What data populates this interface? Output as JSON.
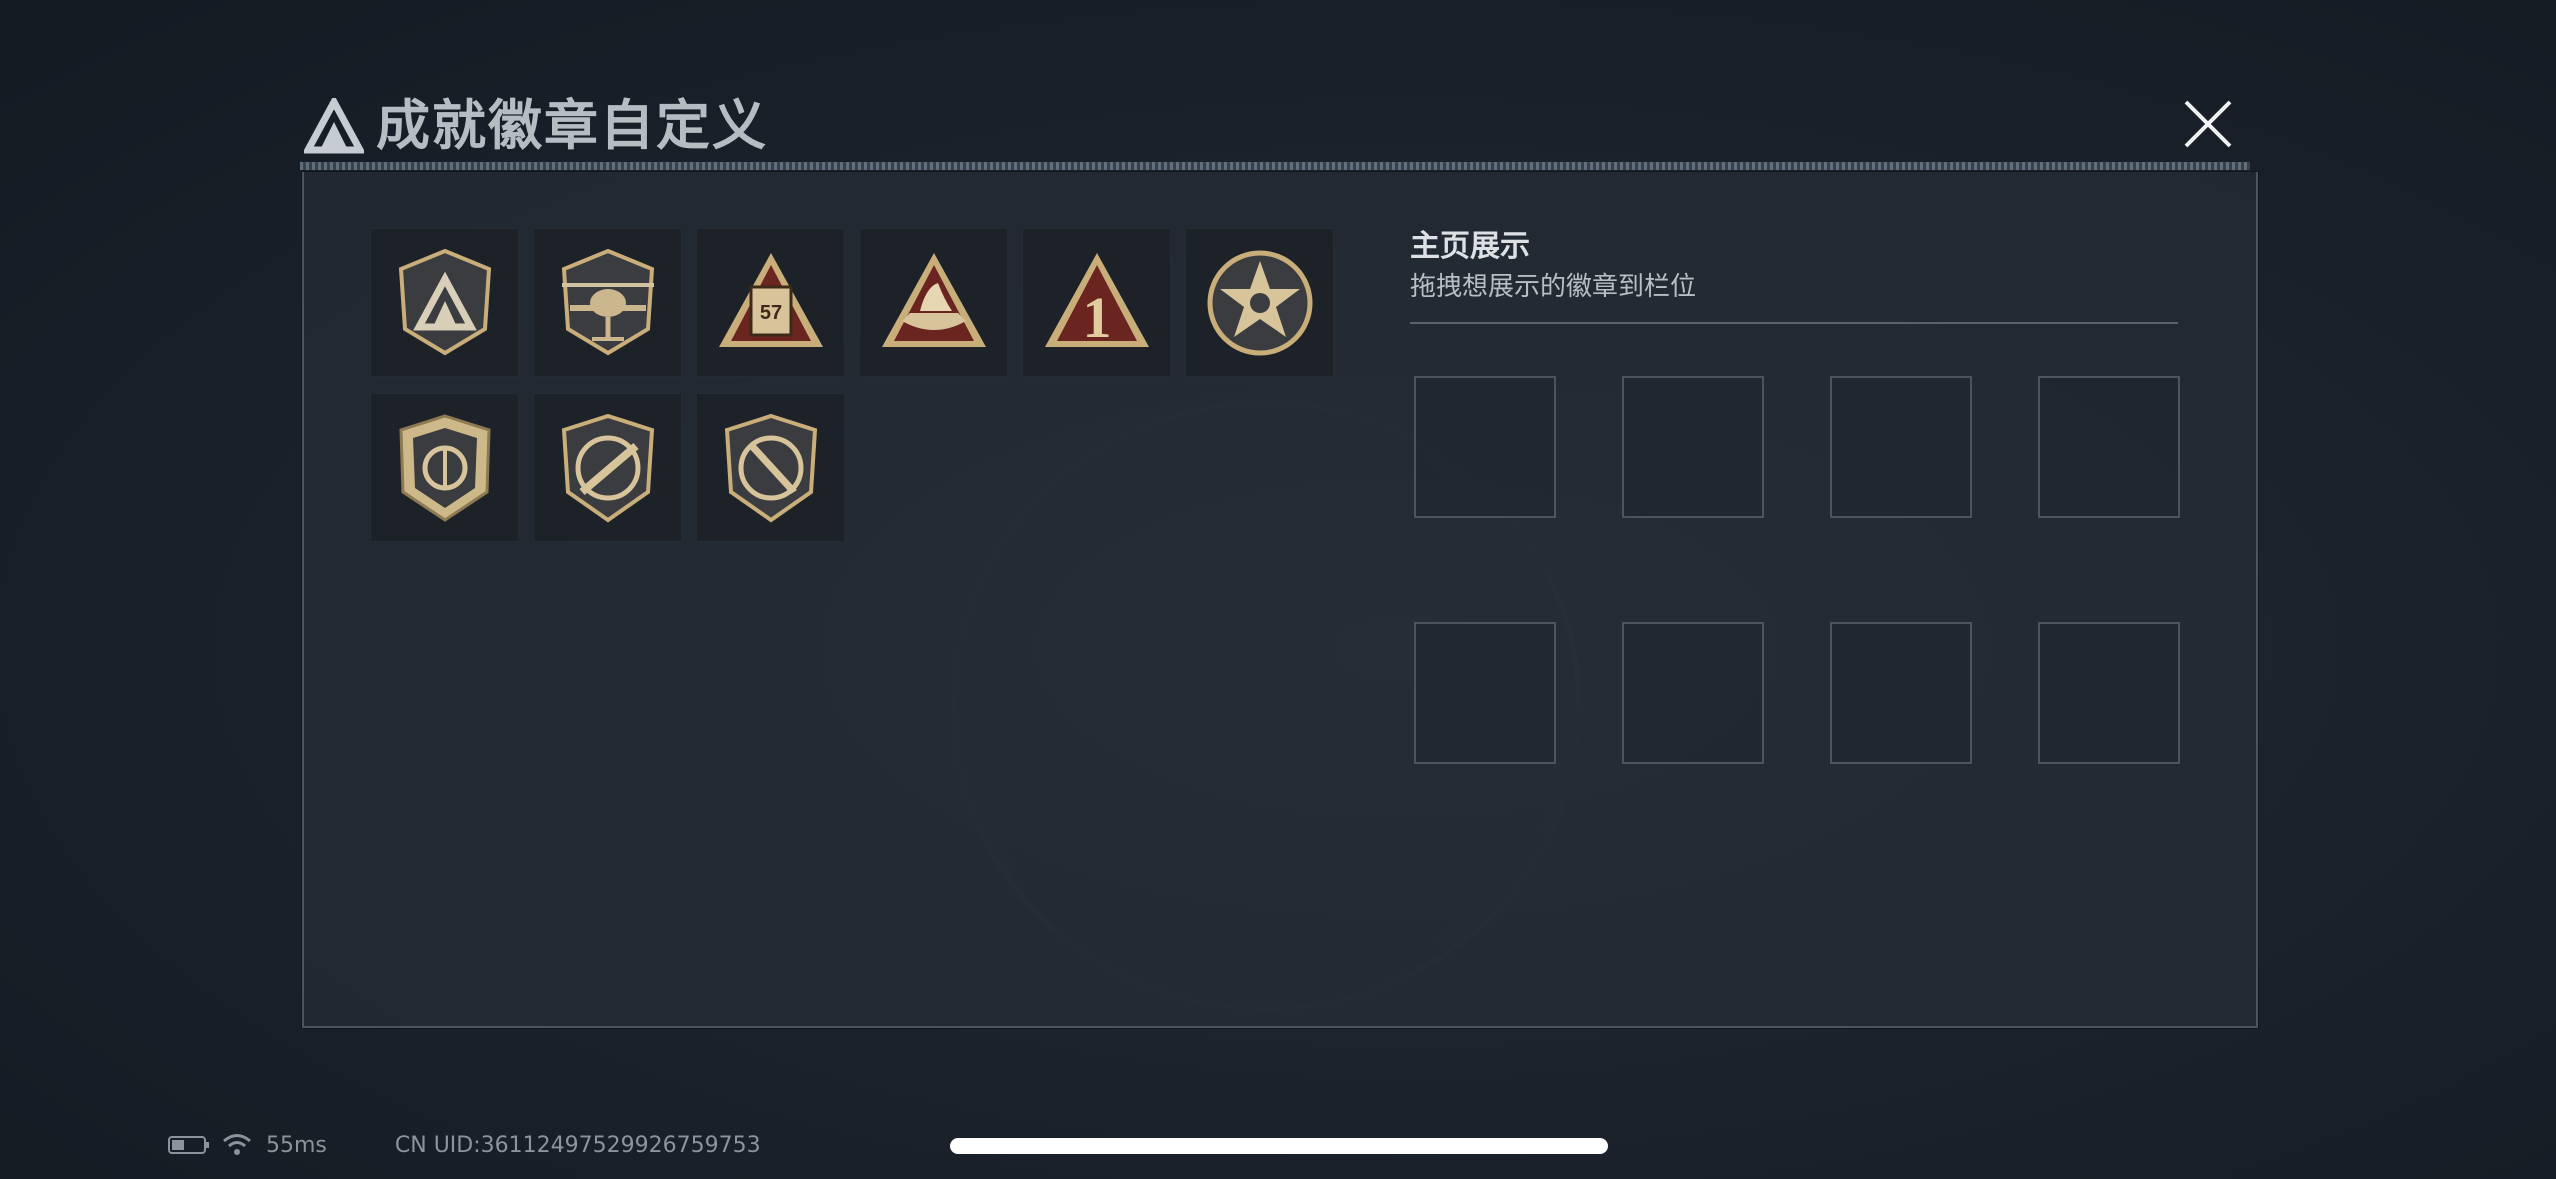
{
  "header": {
    "title": "成就徽章自定义",
    "logo_icon": "delta-triangle-logo-icon",
    "close_icon": "close-icon"
  },
  "badges": [
    {
      "name": "shield-delta-badge"
    },
    {
      "name": "helicopter-badge",
      "icon": "helicopter-icon"
    },
    {
      "name": "crate-57-badge",
      "text": "57"
    },
    {
      "name": "ship-triangle-badge"
    },
    {
      "name": "rank-one-badge",
      "text": "1"
    },
    {
      "name": "star-circle-badge"
    },
    {
      "name": "emblem-shield-badge"
    },
    {
      "name": "rifle-shield-badge"
    },
    {
      "name": "knife-shield-badge"
    }
  ],
  "showcase": {
    "title": "主页展示",
    "subtitle": "拖拽想展示的徽章到栏位",
    "slot_count": 8
  },
  "status_bar": {
    "ping": "55ms",
    "uid": "CN UID:36112497529926759753"
  },
  "colors": {
    "badge_gold": "#c9ae7a",
    "badge_dark": "#2f3237",
    "badge_red": "#6b2520"
  }
}
